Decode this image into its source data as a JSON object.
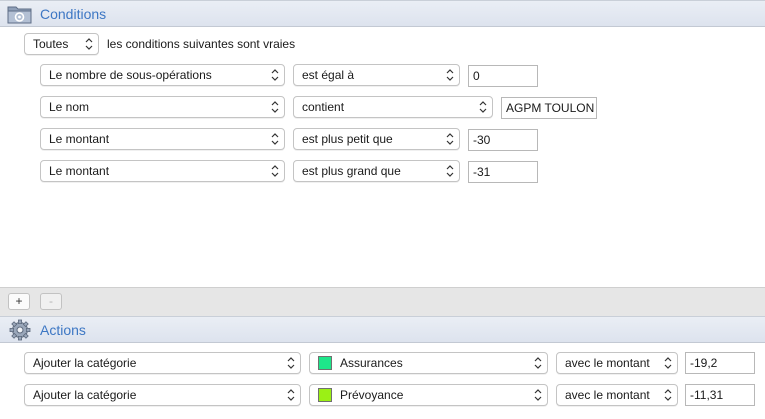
{
  "conditions": {
    "title": "Conditions",
    "icon": "gear-folder-icon",
    "match_select": "Toutes",
    "match_text": "les conditions suivantes sont vraies",
    "rows": [
      {
        "field": "Le nombre de sous-opérations",
        "operator": "est égal à",
        "value": "0"
      },
      {
        "field": "Le nom",
        "operator": "contient",
        "value": "AGPM TOULON"
      },
      {
        "field": "Le montant",
        "operator": "est plus petit que",
        "value": "-30"
      },
      {
        "field": "Le montant",
        "operator": "est plus grand que",
        "value": "-31"
      }
    ]
  },
  "toolbar": {
    "add_label": "+",
    "remove_label": "-"
  },
  "actions": {
    "title": "Actions",
    "icon": "gear-icon",
    "rows": [
      {
        "action": "Ajouter la catégorie",
        "category": "Assurances",
        "category_color": "#1ee68a",
        "amount_mode": "avec le montant",
        "amount": "-19,2"
      },
      {
        "action": "Ajouter la catégorie",
        "category": "Prévoyance",
        "category_color": "#9bf015",
        "amount_mode": "avec le montant",
        "amount": "-11,31"
      }
    ]
  }
}
